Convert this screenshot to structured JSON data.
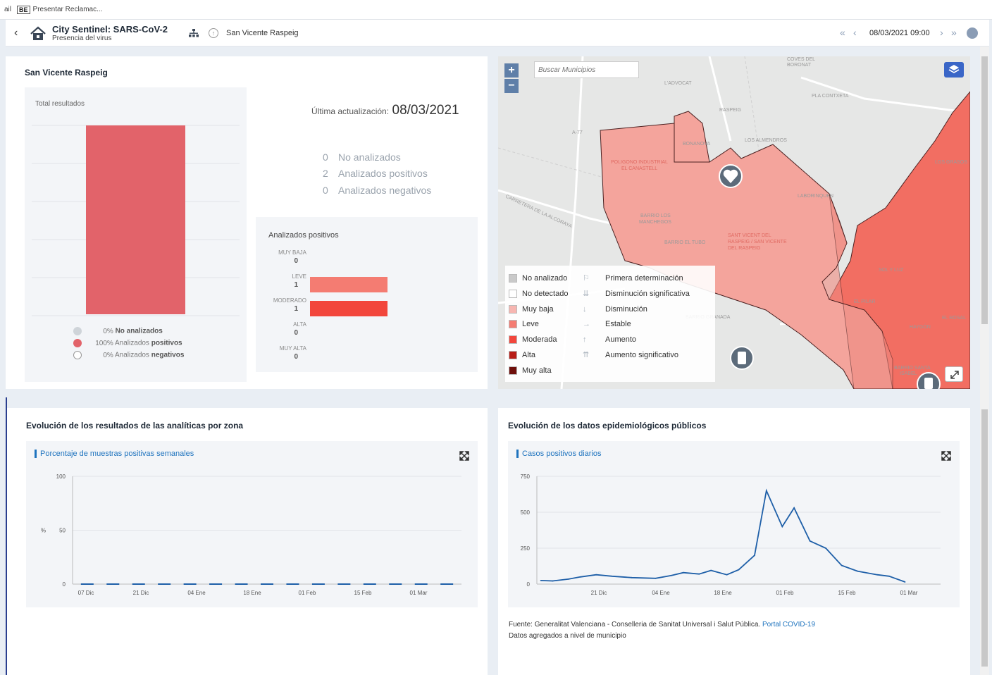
{
  "browser": {
    "tab_prefix": "ail",
    "bookmark_badge": "BE",
    "bookmark_label": "Presentar Reclamac..."
  },
  "header": {
    "back_glyph": "‹",
    "title": "City Sentinel: SARS-CoV-2",
    "subtitle": "Presencia del virus",
    "breadcrumb": "San Vicente Raspeig",
    "nav_first": "«",
    "nav_prev": "‹",
    "date": "08/03/2021 09:00",
    "nav_next": "›",
    "nav_last": "»"
  },
  "summary": {
    "location": "San Vicente Raspeig",
    "total_label": "Total resultados",
    "last_update_label": "Última actualización:",
    "last_update_value": "08/03/2021",
    "stats": [
      {
        "value": "0",
        "label": "No analizados"
      },
      {
        "value": "2",
        "label": "Analizados positivos"
      },
      {
        "value": "0",
        "label": "Analizados negativos"
      }
    ],
    "pct_legend": [
      {
        "pct": "0%",
        "pre": "No analizados",
        "bold": "",
        "color": "#cfd4d9"
      },
      {
        "pct": "100%",
        "pre": "Analizados",
        "bold": "positivos",
        "color": "#e2636a"
      },
      {
        "pct": "0%",
        "pre": "Analizados",
        "bold": "negativos",
        "color": "#ffffff"
      }
    ],
    "bar_share": 1.0,
    "bar_color": "#e2636a"
  },
  "positives": {
    "title": "Analizados positivos",
    "levels": [
      {
        "label": "MUY BAJA",
        "value": "0",
        "fraction": 0,
        "color": "#f2a8a4"
      },
      {
        "label": "LEVE",
        "value": "1",
        "fraction": 1,
        "color": "#f47c72"
      },
      {
        "label": "MODERADO",
        "value": "1",
        "fraction": 1,
        "color": "#f2463c"
      },
      {
        "label": "ALTA",
        "value": "0",
        "fraction": 0,
        "color": "#b81d17"
      },
      {
        "label": "MUY ALTA",
        "value": "0",
        "fraction": 0,
        "color": "#6e0f0b"
      }
    ]
  },
  "map": {
    "search_placeholder": "Buscar Municipios",
    "zoom_in": "+",
    "zoom_out": "−",
    "labels": [
      "COVES DEL BORONAT",
      "L'ADVOCAT",
      "RASPEIG",
      "PLA CONTXETA",
      "A-77",
      "BONANOVA",
      "LOS ALMENDROS",
      "POLIGONO INDUSTRIAL EL CANASTELL",
      "LOS GRASOS",
      "LABORINQUEN",
      "BARRIO LOS MANCHEGOS",
      "BARRIO EL TUBO",
      "SANT VICENT DEL RASPEIG / SAN VICENTE DEL RASPEIG",
      "SOL Y LUZ",
      "EL PILAR",
      "BARRIO GRANADA",
      "EL ROSAL",
      "HAYGÓN",
      "BARRIO SANTA ISABEL",
      "CARRETERA DE LA ALCORAYA"
    ],
    "legend_levels": [
      {
        "label": "No analizado",
        "color": "#c9c9c9"
      },
      {
        "label": "No detectado",
        "color": "#ffffff"
      },
      {
        "label": "Muy baja",
        "color": "#f7b6b1"
      },
      {
        "label": "Leve",
        "color": "#f47c72"
      },
      {
        "label": "Moderada",
        "color": "#f2463c"
      },
      {
        "label": "Alta",
        "color": "#b81d17"
      },
      {
        "label": "Muy alta",
        "color": "#6e0f0b"
      }
    ],
    "legend_trends": [
      {
        "icon": "⚐",
        "label": "Primera determinación"
      },
      {
        "icon": "⇊",
        "label": "Disminución significativa"
      },
      {
        "icon": "↓",
        "label": "Disminución"
      },
      {
        "icon": "→",
        "label": "Estable"
      },
      {
        "icon": "↑",
        "label": "Aumento"
      },
      {
        "icon": "⇈",
        "label": "Aumento significativo"
      }
    ]
  },
  "evolution": {
    "title": "Evolución de los resultados de las analíticas por zona",
    "chart_title": "Porcentaje de muestras positivas semanales"
  },
  "epi": {
    "title": "Evolución de los datos epidemiológicos públicos",
    "chart_title": "Casos positivos diarios",
    "source_text": "Fuente: Generalitat Valenciana - Conselleria de Sanitat Universal i Salut Pública.",
    "source_link": "Portal COVID-19",
    "note": "Datos agregados a nivel de municipio"
  },
  "chart_data": [
    {
      "type": "line",
      "title": "Porcentaje de muestras positivas semanales",
      "ylabel": "%",
      "ylim": [
        0,
        100
      ],
      "yticks": [
        0,
        50,
        100
      ],
      "xtick_labels": [
        "07 Dic",
        "21 Dic",
        "04 Ene",
        "18 Ene",
        "01 Feb",
        "15 Feb",
        "01 Mar"
      ],
      "x": [
        "2020-11-30",
        "2020-12-07",
        "2020-12-14",
        "2020-12-21",
        "2020-12-28",
        "2021-01-04",
        "2021-01-11",
        "2021-01-18",
        "2021-01-25",
        "2021-02-01",
        "2021-02-08",
        "2021-02-15",
        "2021-02-22",
        "2021-03-01",
        "2021-03-08"
      ],
      "series": [
        {
          "values": [
            0,
            0,
            0,
            0,
            0,
            0,
            0,
            0,
            0,
            0,
            0,
            0,
            0,
            0,
            0
          ]
        }
      ],
      "grid": true
    },
    {
      "type": "line",
      "title": "Casos positivos diarios",
      "ylim": [
        0,
        750
      ],
      "yticks": [
        0,
        250,
        500,
        750
      ],
      "xtick_labels": [
        "21 Dic",
        "04 Ene",
        "18 Ene",
        "01 Feb",
        "15 Feb",
        "01 Mar"
      ],
      "x": [
        "2020-12-01",
        "2020-12-04",
        "2020-12-08",
        "2020-12-11",
        "2020-12-15",
        "2020-12-19",
        "2020-12-24",
        "2020-12-30",
        "2021-01-03",
        "2021-01-06",
        "2021-01-10",
        "2021-01-13",
        "2021-01-17",
        "2021-01-20",
        "2021-01-24",
        "2021-01-27",
        "2021-01-31",
        "2021-02-03",
        "2021-02-07",
        "2021-02-11",
        "2021-02-15",
        "2021-02-19",
        "2021-02-24",
        "2021-02-27",
        "2021-03-03"
      ],
      "series": [
        {
          "values": [
            25,
            22,
            35,
            50,
            65,
            55,
            45,
            40,
            60,
            80,
            70,
            95,
            65,
            100,
            200,
            650,
            400,
            530,
            300,
            250,
            130,
            90,
            65,
            55,
            15
          ]
        }
      ],
      "grid": true
    }
  ]
}
